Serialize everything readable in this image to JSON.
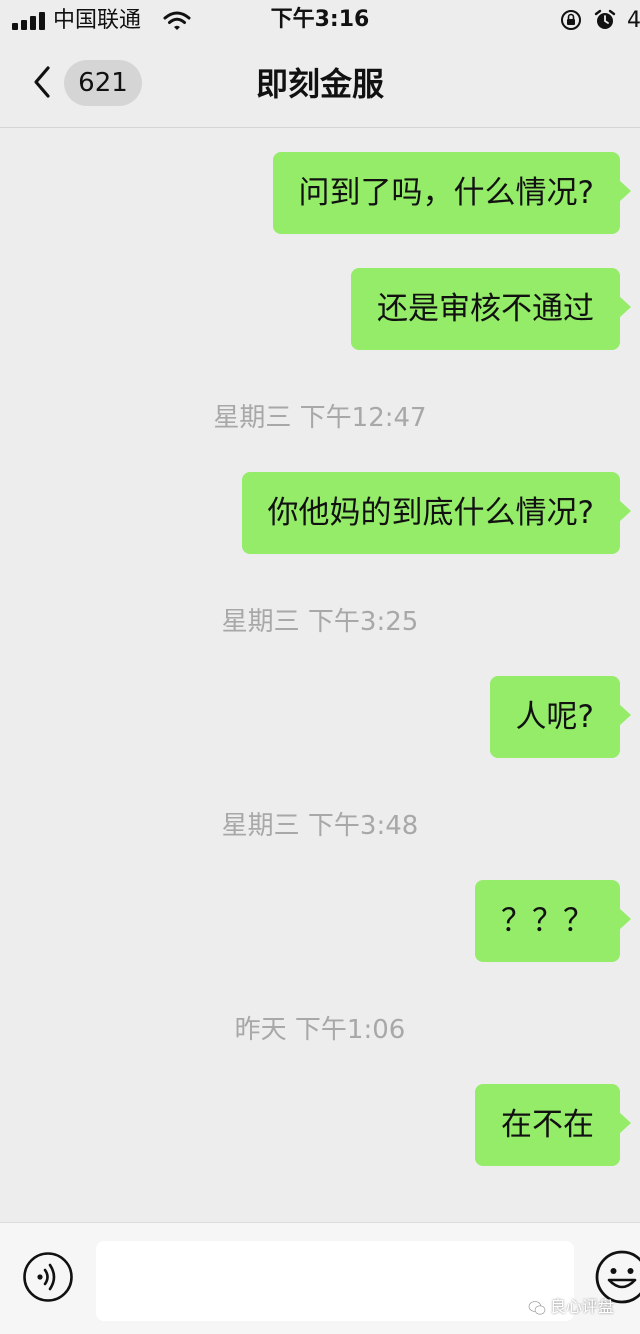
{
  "status_bar": {
    "carrier": "中国联通",
    "time": "下午3:16",
    "extra": "4"
  },
  "nav": {
    "unread_count": "621",
    "title": "即刻金服"
  },
  "messages": [
    {
      "type": "sent",
      "text": "问到了吗，什么情况?"
    },
    {
      "type": "sent",
      "text": "还是审核不通过"
    },
    {
      "type": "time",
      "text": "星期三 下午12:47"
    },
    {
      "type": "sent",
      "text": "你他妈的到底什么情况?"
    },
    {
      "type": "time",
      "text": "星期三 下午3:25"
    },
    {
      "type": "sent",
      "text": "人呢?"
    },
    {
      "type": "time",
      "text": "星期三 下午3:48"
    },
    {
      "type": "sent",
      "text": "？？？"
    },
    {
      "type": "time",
      "text": "昨天 下午1:06"
    },
    {
      "type": "sent",
      "text": "在不在"
    }
  ],
  "input": {
    "value": "",
    "placeholder": ""
  },
  "watermark": {
    "text": "良心评盘"
  },
  "colors": {
    "background": "#ededed",
    "sent_bubble": "#95ec69",
    "timestamp": "#a8a8a8",
    "input_bar": "#f6f6f6"
  },
  "icons": {
    "back": "chevron-left-icon",
    "voice": "voice-icon",
    "emoji": "emoji-icon",
    "wifi": "wifi-icon",
    "signal": "signal-icon",
    "lock": "rotation-lock-icon",
    "alarm": "alarm-icon"
  }
}
